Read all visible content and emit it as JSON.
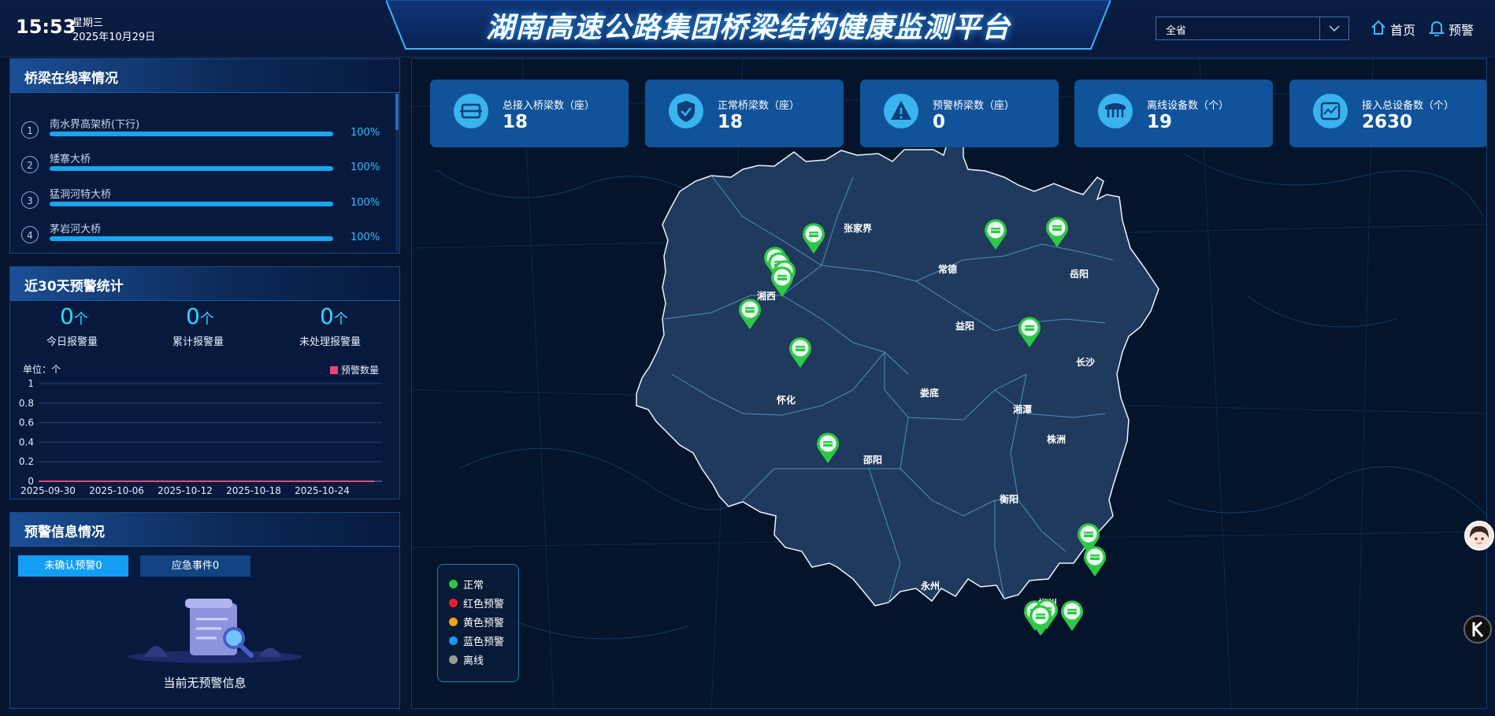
{
  "header": {
    "time": "15:53",
    "weekday": "星期三",
    "date": "2025年10月29日",
    "title": "湖南高速公路集团桥梁结构健康监测平台",
    "region_select": "全省",
    "nav_home": "首页",
    "nav_alarm": "预警"
  },
  "online_panel": {
    "title": "桥梁在线率情况",
    "bridges": [
      {
        "index": "1",
        "name": "南水界高架桥(下行)",
        "rate": "100%",
        "rate_value": 1.0
      },
      {
        "index": "2",
        "name": "矮寨大桥",
        "rate": "100%",
        "rate_value": 1.0
      },
      {
        "index": "3",
        "name": "猛洞河特大桥",
        "rate": "100%",
        "rate_value": 1.0
      },
      {
        "index": "4",
        "name": "茅岩河大桥",
        "rate": "100%",
        "rate_value": 1.0
      }
    ]
  },
  "warn30_panel": {
    "title": "近30天预警统计",
    "stats": [
      {
        "value": "0",
        "unit": "个",
        "label": "今日报警量"
      },
      {
        "value": "0",
        "unit": "个",
        "label": "累计报警量"
      },
      {
        "value": "0",
        "unit": "个",
        "label": "未处理报警量"
      }
    ],
    "unit_label": "单位：个"
  },
  "chart_data": {
    "type": "line",
    "x": [
      "2025-09-30",
      "2025-10-06",
      "2025-10-12",
      "2025-10-18",
      "2025-10-24"
    ],
    "xticks": [
      "2025-09-30",
      "2025-10-06",
      "2025-10-12",
      "2025-10-18",
      "2025-10-24"
    ],
    "series": [
      {
        "name": "预警数量",
        "values": [
          0,
          0,
          0,
          0,
          0
        ],
        "color": "#e8457a"
      }
    ],
    "ylim": [
      0,
      1
    ],
    "yticks": [
      "1",
      "0.8",
      "0.6",
      "0.4",
      "0.2",
      "0"
    ],
    "ylabel": "单位：个",
    "legend_position": "top-right",
    "grid": true
  },
  "info_panel": {
    "title": "预警信息情况",
    "tab_unconfirmed": "未确认预警0",
    "tab_emergency": "应急事件0",
    "empty_text": "当前无预警信息"
  },
  "kpis": [
    {
      "label": "总接入桥梁数（座）",
      "value": "18",
      "icon": "bridge-icon"
    },
    {
      "label": "正常桥梁数（座）",
      "value": "18",
      "icon": "shield-check-icon"
    },
    {
      "label": "预警桥梁数（座）",
      "value": "0",
      "icon": "warning-icon"
    },
    {
      "label": "离线设备数（个）",
      "value": "19",
      "icon": "offline-bridge-icon"
    },
    {
      "label": "接入总设备数（个）",
      "value": "2630",
      "icon": "device-icon"
    }
  ],
  "map": {
    "cities": [
      "张家界",
      "常德",
      "岳阳",
      "湘西",
      "益阳",
      "长沙",
      "娄底",
      "怀化",
      "湘潭",
      "株洲",
      "邵阳",
      "衡阳",
      "永州",
      "郴州"
    ],
    "legend": [
      {
        "label": "正常",
        "color": "#2fc846"
      },
      {
        "label": "红色预警",
        "color": "#e8202a"
      },
      {
        "label": "黄色预警",
        "color": "#f0a318"
      },
      {
        "label": "蓝色预警",
        "color": "#1b97e6"
      },
      {
        "label": "离线",
        "color": "#9a9a9a"
      }
    ],
    "marker_color": "#2fc846"
  }
}
